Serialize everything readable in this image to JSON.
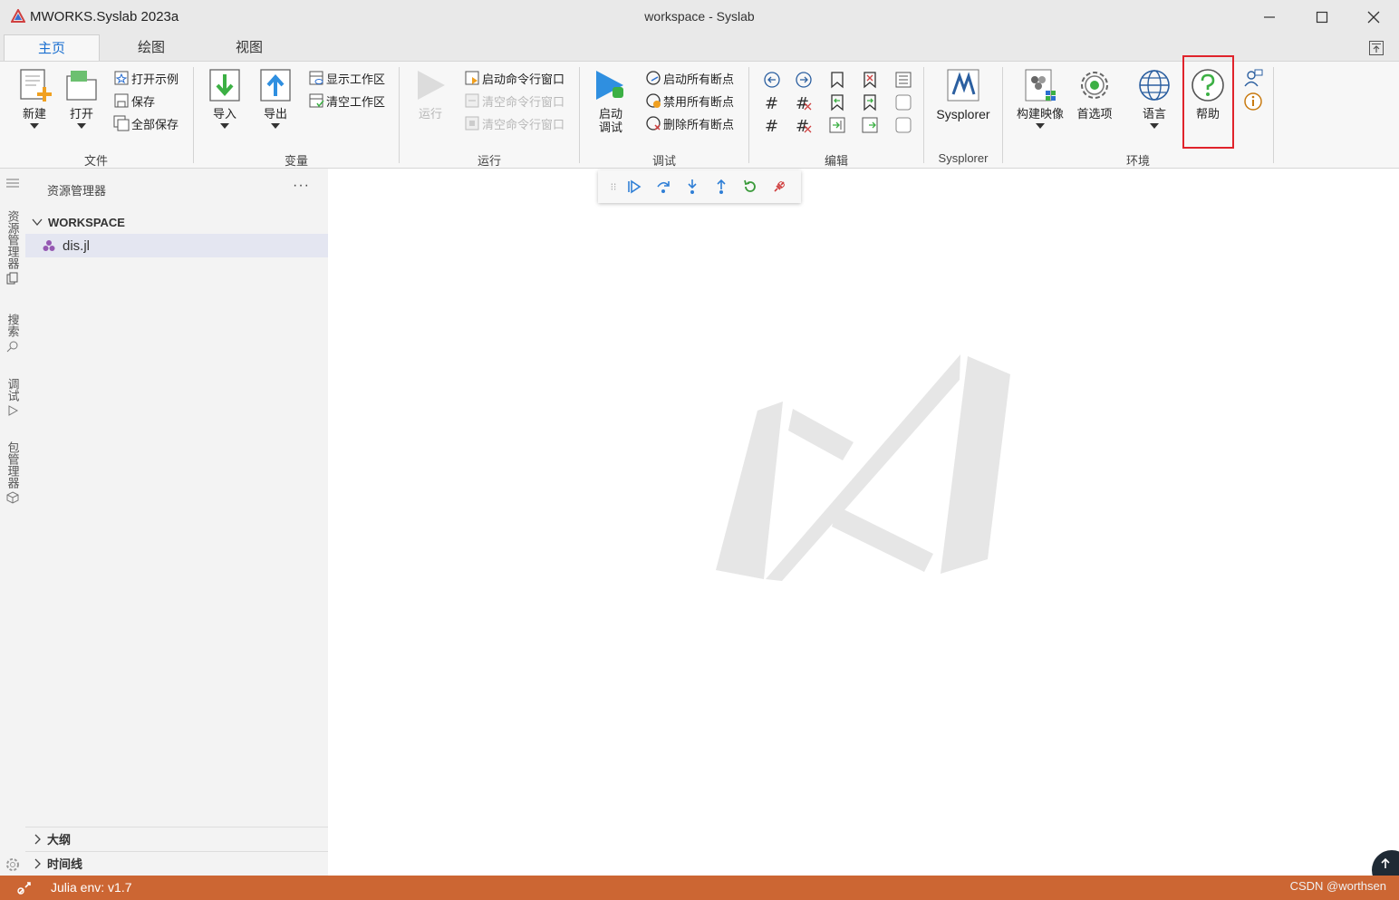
{
  "window": {
    "app_name": "MWORKS.Syslab 2023a",
    "title": "workspace - Syslab"
  },
  "tabs": [
    {
      "label": "主页",
      "active": true
    },
    {
      "label": "绘图",
      "active": false
    },
    {
      "label": "视图",
      "active": false
    }
  ],
  "ribbon": {
    "file": {
      "group": "文件",
      "new": "新建",
      "open": "打开",
      "open_example": "打开示例",
      "save": "保存",
      "save_all": "全部保存"
    },
    "variables": {
      "group": "变量",
      "import": "导入",
      "export": "导出",
      "show_workspace": "显示工作区",
      "clear_workspace": "清空工作区"
    },
    "run": {
      "group": "运行",
      "run": "运行",
      "start_repl": "启动命令行窗口",
      "clear_repl": "清空命令行窗口",
      "stop_repl": "清空命令行窗口"
    },
    "debug": {
      "group": "调试",
      "start_debug_line1": "启动",
      "start_debug_line2": "调试",
      "enable_bp": "启动所有断点",
      "disable_bp": "禁用所有断点",
      "delete_bp": "删除所有断点"
    },
    "edit": {
      "group": "编辑"
    },
    "sysplorer": {
      "group": "Sysplorer",
      "button": "Sysplorer"
    },
    "environment": {
      "group": "环境",
      "build_image": "构建映像",
      "preferences": "首选项",
      "language": "语言",
      "help": "帮助"
    }
  },
  "activity_bar": {
    "explorer": "资源管理器",
    "search": "搜索",
    "debug": "调试",
    "packages": "包管理器"
  },
  "sidebar": {
    "title": "资源管理器",
    "more": "···",
    "workspace": "WORKSPACE",
    "files": [
      "dis.jl"
    ],
    "outline": "大纲",
    "timeline": "时间线"
  },
  "statusbar": {
    "env": "Julia env: v1.7",
    "credit": "CSDN @worthsen"
  },
  "colors": {
    "accent": "#1a6fd0",
    "status_bar": "#cc6633",
    "highlight": "#e0232b"
  }
}
